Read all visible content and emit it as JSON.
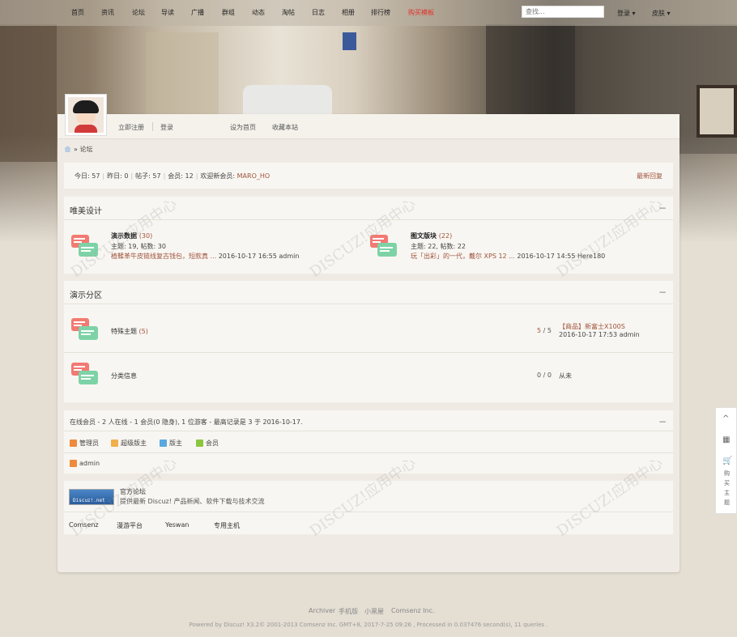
{
  "nav": {
    "items": [
      {
        "label": "首页"
      },
      {
        "label": "资讯"
      },
      {
        "label": "论坛"
      },
      {
        "label": "导读"
      },
      {
        "label": "广播"
      },
      {
        "label": "群组"
      },
      {
        "label": "动态"
      },
      {
        "label": "淘帖"
      },
      {
        "label": "日志"
      },
      {
        "label": "相册"
      },
      {
        "label": "排行榜"
      },
      {
        "label": "购买模板"
      }
    ],
    "search_placeholder": "查找...",
    "login": "登录",
    "skin": "皮肤"
  },
  "userbar": {
    "register": "立即注册",
    "login": "登录",
    "set_home": "设为首页",
    "bookmark": "收藏本站"
  },
  "breadcrumb": {
    "sep": "»",
    "current": "论坛"
  },
  "stats": {
    "today": "今日: 57",
    "yesterday": "昨日: 0",
    "posts": "帖子: 57",
    "members": "会员: 12",
    "welcome_label": "欢迎新会员: ",
    "new_member": "MARO_HO",
    "latest_reply": "最新回复"
  },
  "section1": {
    "title": "唯美设计",
    "collapse": "−",
    "forums": [
      {
        "name": "演示数据",
        "count": "(30)",
        "meta": "主题: 19, 帖数: 30",
        "last_title": "植鞣革牛皮链线复古钱包，短款真 ...",
        "last_info": " 2016-10-17 16:55 admin"
      },
      {
        "name": "图文版块",
        "count": "(22)",
        "meta": "主题: 22, 帖数: 22",
        "last_title": "玩「出彩」的一代，戴尔 XPS 12 ...",
        "last_info": " 2016-10-17 14:55 Here180"
      }
    ]
  },
  "section2": {
    "title": "演示分区",
    "collapse": "−",
    "rows": [
      {
        "name": "特殊主题",
        "count": "(5)",
        "stat_a": "5",
        "stat_b": " / 5",
        "last_title": "【商品】新富士X100S",
        "last_info": "2016-10-17 17:53 admin"
      },
      {
        "name": "分类信息",
        "count": "",
        "stat_a": "0",
        "stat_b": " / 0",
        "last_title": "",
        "last_info": "从未"
      }
    ]
  },
  "online": {
    "summary": "在线会员 - 2 人在线 - 1 会员(0 隐身), 1 位游客 - 最高记录是 3 于 2016-10-17.",
    "collapse": "−",
    "legend": [
      {
        "label": "管理员",
        "color": "#ee8a3c"
      },
      {
        "label": "超级版主",
        "color": "#f0b04a"
      },
      {
        "label": "版主",
        "color": "#5aa8e0"
      },
      {
        "label": "会员",
        "color": "#8cc63f"
      }
    ],
    "user": "admin"
  },
  "links": {
    "logo_text": "Discuz!.net",
    "title": "官方论坛",
    "desc": "提供最新 Discuz! 产品新闻、软件下载与技术交流",
    "friends": [
      "Comsenz",
      "漫游平台",
      "Yeswan",
      "专用主机"
    ]
  },
  "footer": {
    "links": [
      "Archiver",
      "手机版",
      "小黑屋",
      "Comsenz Inc."
    ],
    "powered": "Powered by Discuz! X3.2© 2001-2013 Comsenz Inc. GMT+8, 2017-7-25 09:26 , Processed in 0.037476 second(s), 11 queries ."
  },
  "sidetool": {
    "up": "^",
    "qr": "▦",
    "cart": "🛒",
    "buy": "购买主题"
  },
  "colors": {
    "accent": "#a0523a",
    "hot": "#e0322a",
    "panel": "#efebe4"
  }
}
